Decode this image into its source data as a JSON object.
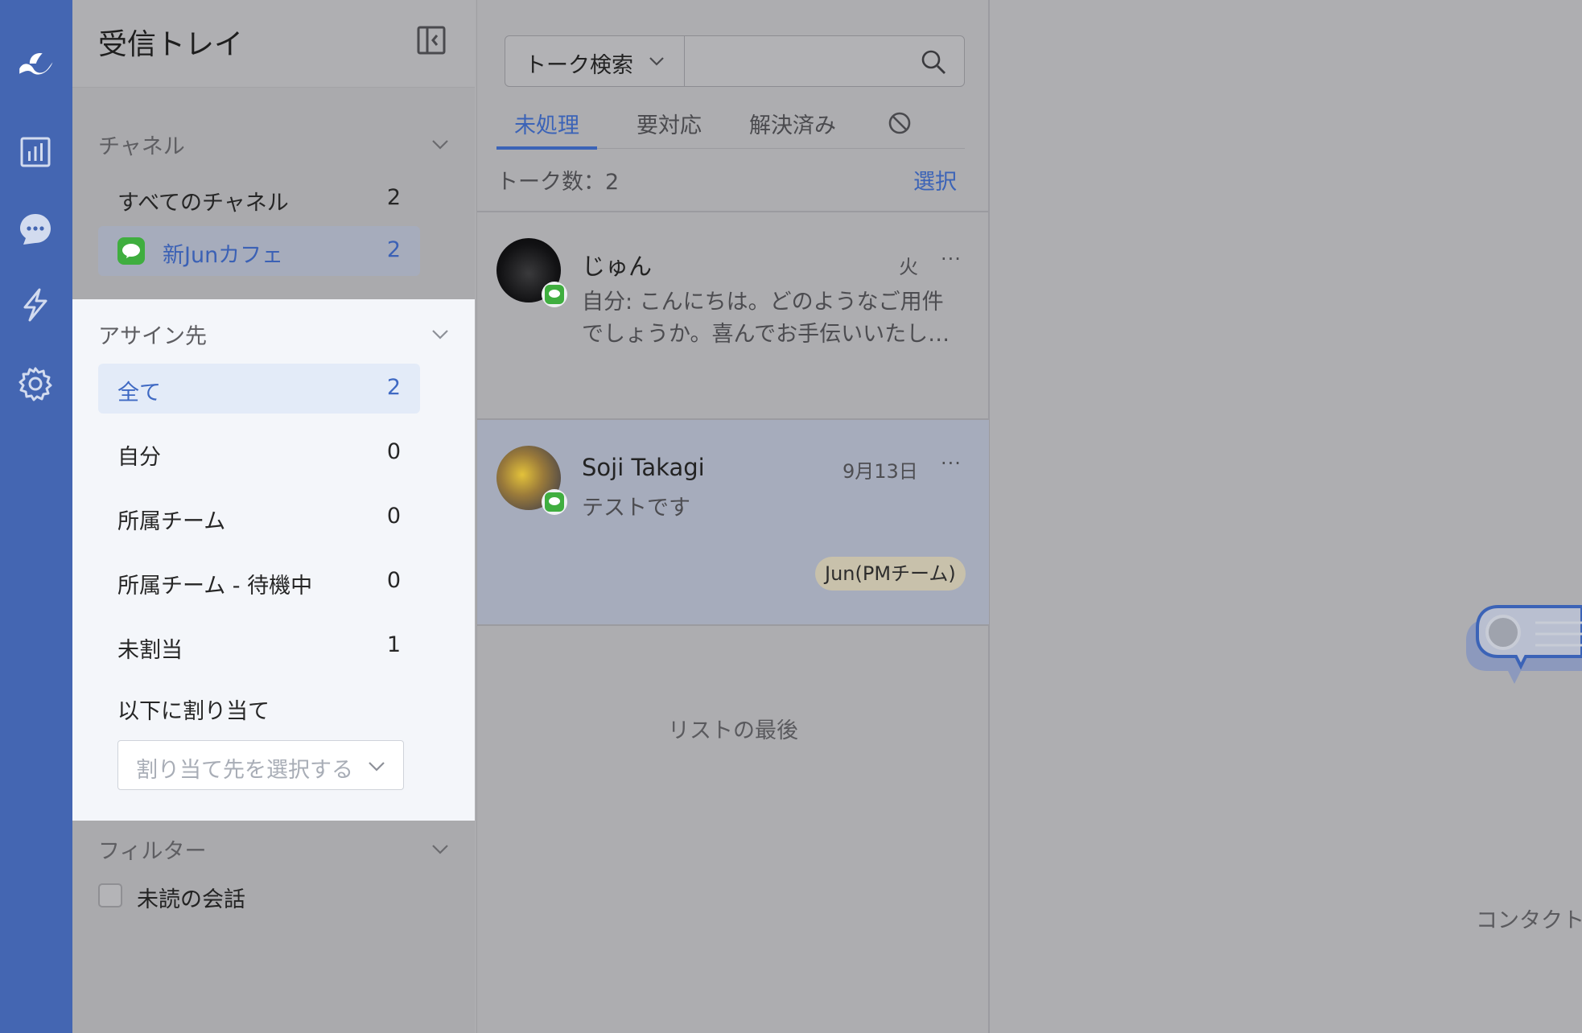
{
  "colors": {
    "rail": "#4466b2",
    "accent": "#3b63b7",
    "line_green": "#3fae3f"
  },
  "rail": {
    "items": [
      {
        "icon": "logo-icon"
      },
      {
        "icon": "analytics-icon"
      },
      {
        "icon": "chat-icon"
      },
      {
        "icon": "automation-icon"
      },
      {
        "icon": "settings-icon"
      }
    ]
  },
  "inbox": {
    "title": "受信トレイ",
    "channel": {
      "label": "チャネル",
      "items": [
        {
          "label": "すべてのチャネル",
          "count": "2"
        },
        {
          "label": "新Junカフェ",
          "count": "2",
          "icon": "line-icon",
          "selected": true
        }
      ]
    },
    "assignee": {
      "label": "アサイン先",
      "items": [
        {
          "label": "全て",
          "count": "2",
          "selected": true
        },
        {
          "label": "自分",
          "count": "0"
        },
        {
          "label": "所属チーム",
          "count": "0"
        },
        {
          "label": "所属チーム - 待機中",
          "count": "0"
        },
        {
          "label": "未割当",
          "count": "1"
        }
      ],
      "assign_to_label": "以下に割り当て",
      "assign_placeholder": "割り当て先を選択する"
    },
    "filter": {
      "label": "フィルター",
      "unread_label": "未読の会話"
    }
  },
  "list": {
    "search_type": "トーク検索",
    "tabs": [
      {
        "label": "未処理",
        "active": true
      },
      {
        "label": "要対応"
      },
      {
        "label": "解決済み"
      },
      {
        "icon": "blocked-icon"
      }
    ],
    "count_text": "トーク数：2",
    "select_label": "選択",
    "conversations": [
      {
        "name": "じゅん",
        "date": "火",
        "preview_lines": [
          "自分: こんにちは。どのようなご用件",
          "でしょうか。喜んでお手伝いいたし…"
        ]
      },
      {
        "name": "Soji Takagi",
        "date": "9月13日",
        "preview_lines": [
          "テストです"
        ],
        "tag": "Jun(PMチーム)"
      }
    ],
    "end_text": "リストの最後"
  },
  "detail": {
    "contact_text": "コンタクト"
  }
}
